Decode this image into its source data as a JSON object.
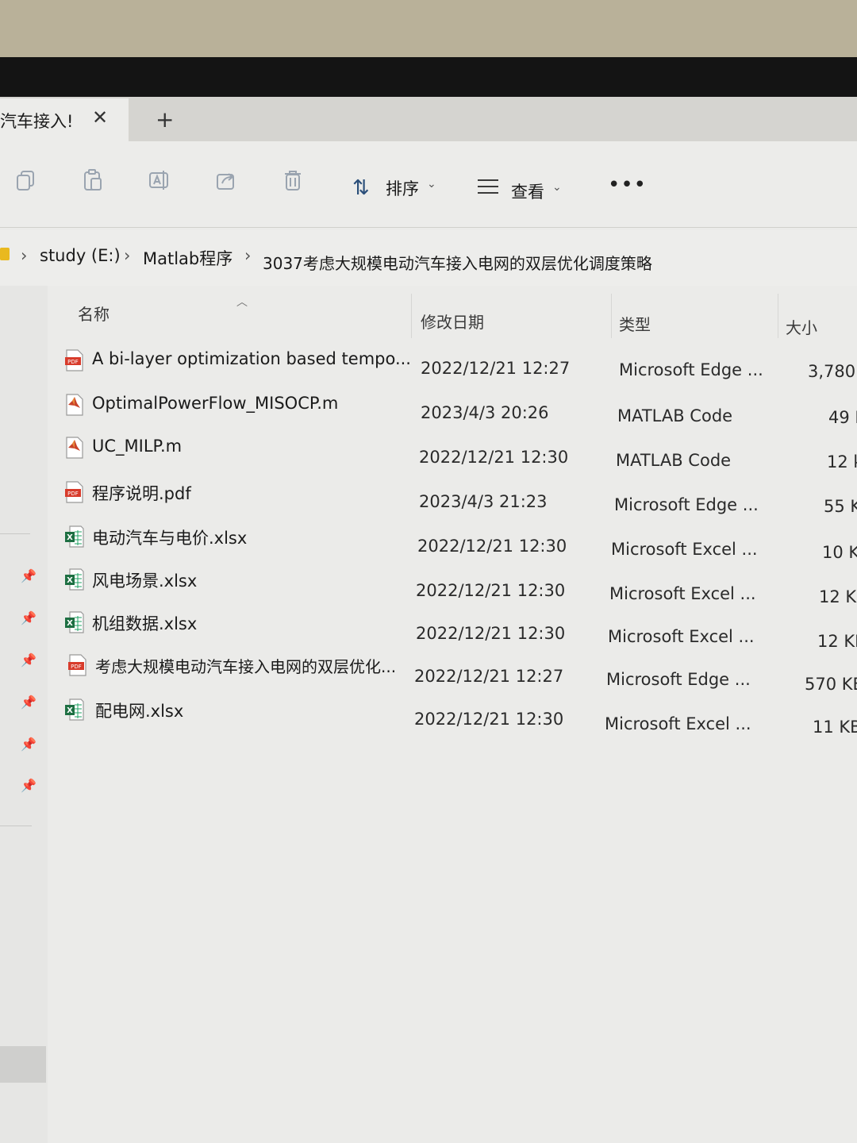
{
  "tab": {
    "title": "汽车接入!",
    "close": "✕",
    "new_tab": "+"
  },
  "toolbar": {
    "icons": [
      "copy-icon",
      "paste-icon",
      "rename-icon",
      "share-icon",
      "delete-icon"
    ],
    "sort_label": "排序",
    "view_label": "查看",
    "more": "•••"
  },
  "breadcrumb": {
    "sep": "›",
    "items": [
      "study (E:)",
      "Matlab程序",
      "3037考虑大规模电动汽车接入电网的双层优化调度策略"
    ]
  },
  "columns": {
    "name": "名称",
    "modified": "修改日期",
    "type": "类型",
    "size": "大小"
  },
  "files": [
    {
      "icon": "pdf-icon",
      "name": "A bi-layer optimization based tempo...",
      "date": "2022/12/21 12:27",
      "type": "Microsoft Edge ...",
      "size": "3,780"
    },
    {
      "icon": "matlab-icon",
      "name": "OptimalPowerFlow_MISOCP.m",
      "date": "2023/4/3 20:26",
      "type": "MATLAB Code",
      "size": "49 I"
    },
    {
      "icon": "matlab-icon",
      "name": "UC_MILP.m",
      "date": "2022/12/21 12:30",
      "type": "MATLAB Code",
      "size": "12 k"
    },
    {
      "icon": "pdf-icon",
      "name": "程序说明.pdf",
      "date": "2023/4/3 21:23",
      "type": "Microsoft Edge ...",
      "size": "55 K"
    },
    {
      "icon": "excel-icon",
      "name": "电动汽车与电价.xlsx",
      "date": "2022/12/21 12:30",
      "type": "Microsoft Excel ...",
      "size": "10 K"
    },
    {
      "icon": "excel-icon",
      "name": "风电场景.xlsx",
      "date": "2022/12/21 12:30",
      "type": "Microsoft Excel ...",
      "size": "12 KI"
    },
    {
      "icon": "excel-icon",
      "name": "机组数据.xlsx",
      "date": "2022/12/21 12:30",
      "type": "Microsoft Excel ...",
      "size": "12 KE"
    },
    {
      "icon": "pdf-icon",
      "name": "考虑大规模电动汽车接入电网的双层优化...",
      "date": "2022/12/21 12:27",
      "type": "Microsoft Edge ...",
      "size": "570 KB"
    },
    {
      "icon": "excel-icon",
      "name": "配电网.xlsx",
      "date": "2022/12/21 12:30",
      "type": "Microsoft Excel ...",
      "size": "11 KB"
    }
  ],
  "sidebar": {
    "pin_icon": "pin-icon",
    "pin_glyph": "📌"
  }
}
